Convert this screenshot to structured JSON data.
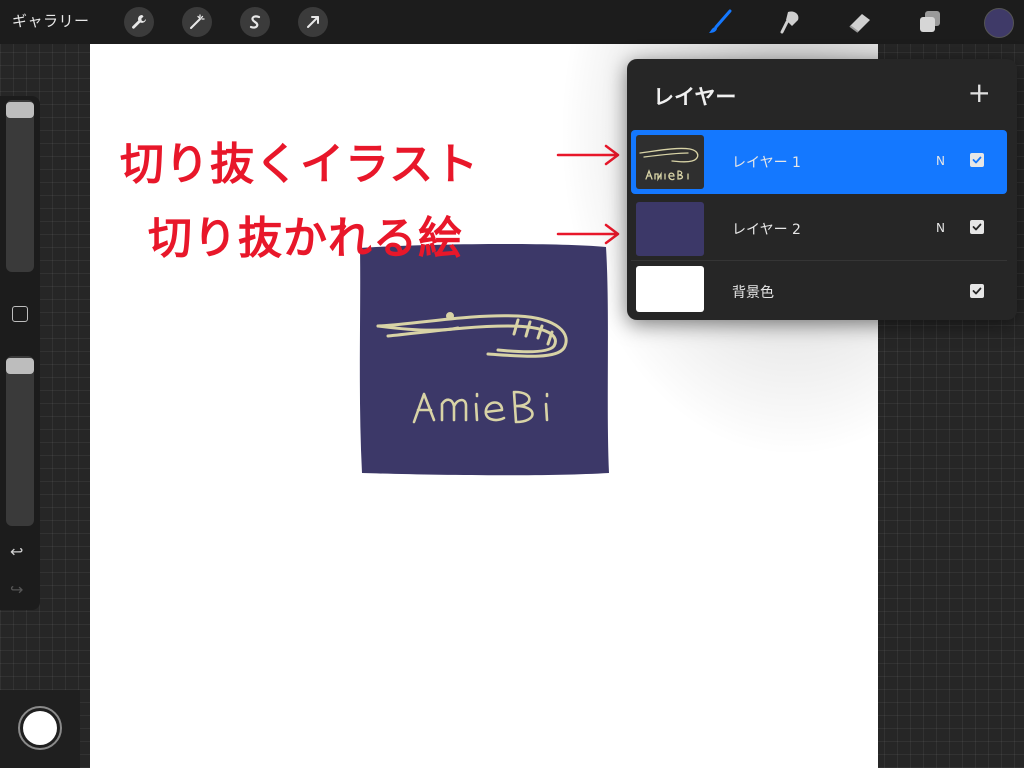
{
  "toolbar": {
    "gallery_label": "ギャラリー",
    "left_tools": [
      "wrench-icon",
      "magic-wand-icon",
      "selection-s-icon",
      "transform-arrow-icon"
    ],
    "right_tools": [
      "brush-icon",
      "smudge-icon",
      "eraser-icon",
      "layers-icon"
    ],
    "brush_color": "#1478ff",
    "current_color": "#3f3a68"
  },
  "annotations": {
    "line1": "切り抜くイラスト",
    "line2": "切り抜かれる絵",
    "color": "#e8172a"
  },
  "artwork": {
    "text": "AmieBi",
    "bg_color": "#3c3868",
    "stroke_color": "#d8d3a6"
  },
  "layers_panel": {
    "title": "レイヤー",
    "add_label": "+",
    "layers": [
      {
        "name": "レイヤー 1",
        "mode": "N",
        "visible": true,
        "selected": true
      },
      {
        "name": "レイヤー 2",
        "mode": "N",
        "visible": true,
        "selected": false
      },
      {
        "name": "背景色",
        "mode": "",
        "visible": true,
        "selected": false
      }
    ],
    "accent": "#1478ff"
  },
  "sidebar": {
    "undo_label": "↩",
    "redo_label": "↪"
  }
}
